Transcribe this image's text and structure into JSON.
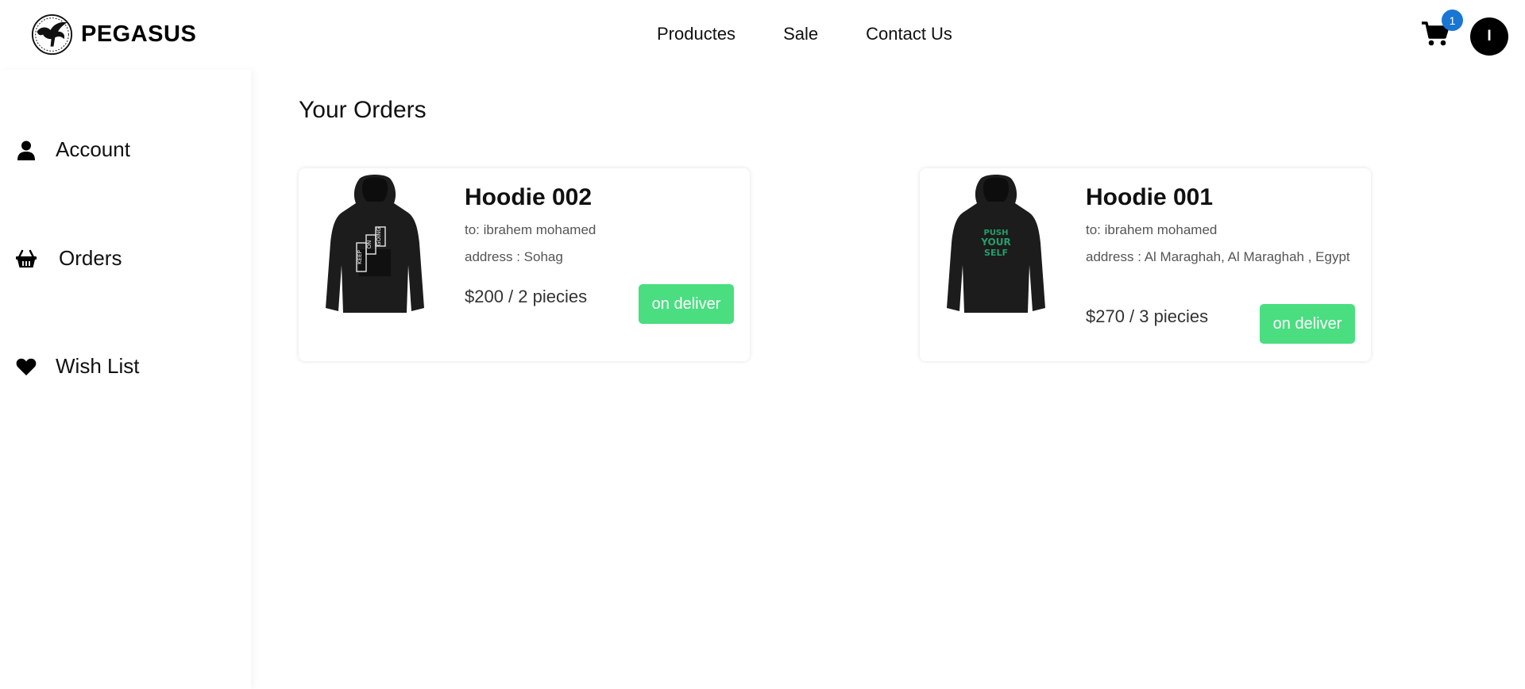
{
  "brand": {
    "name": "PEGASUS",
    "logo_icon": "pegasus-logo-icon"
  },
  "nav": {
    "links": [
      {
        "label": "Productes"
      },
      {
        "label": "Sale"
      },
      {
        "label": "Contact Us"
      }
    ]
  },
  "header": {
    "cart_icon": "cart-icon",
    "cart_count": "1",
    "avatar_initial": "I",
    "colors": {
      "badge": "#1976d2",
      "avatar": "#000000"
    }
  },
  "sidebar": {
    "items": [
      {
        "label": "Account",
        "icon": "user-icon"
      },
      {
        "label": "Orders",
        "icon": "basket-icon"
      },
      {
        "label": "Wish List",
        "icon": "heart-icon"
      }
    ]
  },
  "main": {
    "title": "Your Orders",
    "orders": [
      {
        "product": "Hoodie 002",
        "recipient": "to: ibrahem mohamed",
        "address": "address : Sohag",
        "price": "$200 / 2 piecies",
        "status": "on deliver",
        "image_print": [
          "KEEP",
          "ON",
          "GOING"
        ]
      },
      {
        "product": "Hoodie 001",
        "recipient": "to: ibrahem mohamed",
        "address": "address : Al Maraghah, Al Maraghah , Egypt",
        "price": "$270 / 3 piecies",
        "status": "on deliver",
        "image_print": [
          "PUSH",
          "YOUR",
          "SELF"
        ]
      }
    ],
    "colors": {
      "status": "#4ade80"
    }
  }
}
